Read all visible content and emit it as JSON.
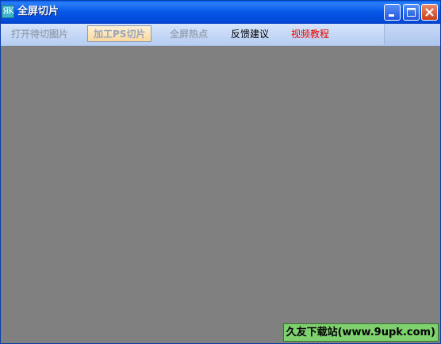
{
  "window": {
    "title": "全屏切片",
    "icon_text": "ЯK",
    "icon": "app-icon",
    "controls": {
      "minimize_icon": "minimize-icon",
      "maximize_icon": "maximize-icon",
      "close_icon": "close-icon"
    }
  },
  "menu": {
    "items": [
      {
        "label": "打开待切图片",
        "state": "disabled"
      },
      {
        "label": "加工PS切片",
        "state": "active"
      },
      {
        "label": "全屏热点",
        "state": "disabled"
      },
      {
        "label": "反馈建议",
        "state": "normal"
      },
      {
        "label": "视频教程",
        "state": "highlight",
        "color": "#e80000"
      }
    ]
  },
  "watermark": {
    "text": "久友下载站(www.9upk.com)"
  },
  "colors": {
    "titlebar": "#0656e6",
    "canvas": "#808080",
    "close_button": "#c8401c",
    "watermark_bg": "#7fd06e"
  }
}
